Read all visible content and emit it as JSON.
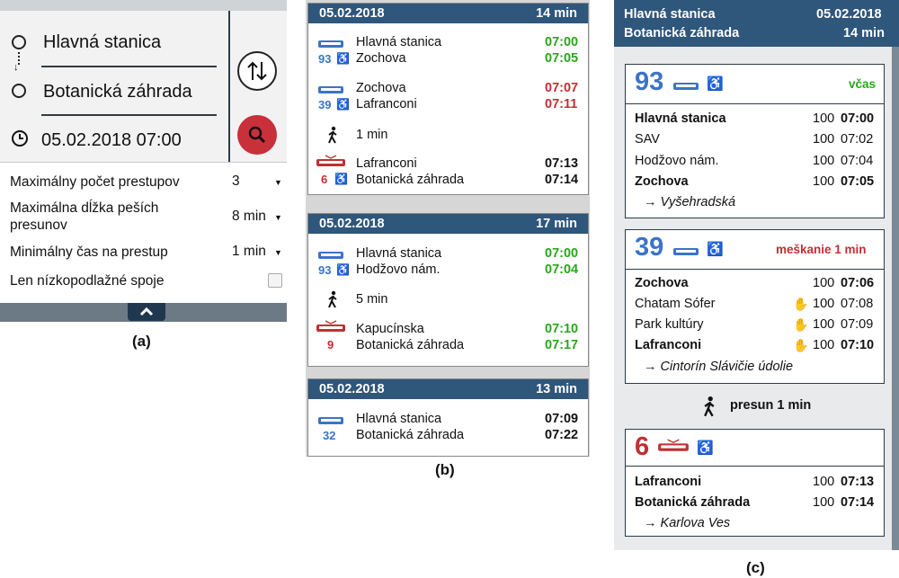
{
  "panel_a": {
    "from": "Hlavná stanica",
    "to": "Botanická záhrada",
    "datetime": "05.02.2018 07:00",
    "options": [
      {
        "label": "Maximálny počet prestupov",
        "value": "3"
      },
      {
        "label": "Maximálna dĺžka peších presunov",
        "value": "8 min"
      },
      {
        "label": "Minimálny čas na prestup",
        "value": "1 min"
      },
      {
        "label": "Len nízkopodlažné spoje",
        "value": ""
      }
    ],
    "caption": "(a)"
  },
  "panel_b": {
    "caption": "(b)",
    "results": [
      {
        "date": "05.02.2018",
        "duration": "14 min",
        "legs": [
          {
            "type": "bus",
            "route": "93",
            "accessible": true,
            "from": "Hlavná stanica",
            "to": "Zochova",
            "dep": "07:00",
            "arr": "07:05",
            "status": "green"
          },
          {
            "type": "bus",
            "route": "39",
            "accessible": true,
            "from": "Zochova",
            "to": "Lafranconi",
            "dep": "07:07",
            "arr": "07:11",
            "status": "red"
          },
          {
            "type": "walk",
            "text": "1 min"
          },
          {
            "type": "tram",
            "route": "6",
            "accessible": true,
            "from": "Lafranconi",
            "to": "Botanická záhrada",
            "dep": "07:13",
            "arr": "07:14",
            "status": "black"
          }
        ]
      },
      {
        "date": "05.02.2018",
        "duration": "17 min",
        "legs": [
          {
            "type": "bus",
            "route": "93",
            "accessible": true,
            "from": "Hlavná stanica",
            "to": "Hodžovo nám.",
            "dep": "07:00",
            "arr": "07:04",
            "status": "green"
          },
          {
            "type": "walk",
            "text": "5 min"
          },
          {
            "type": "tram",
            "route": "9",
            "accessible": false,
            "from": "Kapucínska",
            "to": "Botanická záhrada",
            "dep": "07:10",
            "arr": "07:17",
            "status": "green"
          }
        ]
      },
      {
        "date": "05.02.2018",
        "duration": "13 min",
        "legs": [
          {
            "type": "bus",
            "route": "32",
            "accessible": false,
            "from": "Hlavná stanica",
            "to": "Botanická záhrada",
            "dep": "07:09",
            "arr": "07:22",
            "status": "black"
          }
        ]
      }
    ]
  },
  "panel_c": {
    "caption": "(c)",
    "header": {
      "from": "Hlavná stanica",
      "date": "05.02.2018",
      "to": "Botanická záhrada",
      "duration": "14 min"
    },
    "legs": [
      {
        "route": "93",
        "mode": "bus",
        "status": "včas",
        "status_color": "#2aa61c",
        "stops": [
          {
            "name": "Hlavná stanica",
            "pos": "100",
            "time": "07:00",
            "bold": true
          },
          {
            "name": "SAV",
            "pos": "100",
            "time": "07:02",
            "bold": false
          },
          {
            "name": "Hodžovo nám.",
            "pos": "100",
            "time": "07:04",
            "bold": false
          },
          {
            "name": "Zochova",
            "pos": "100",
            "time": "07:05",
            "bold": true
          }
        ],
        "direction": "→ Vyšehradská"
      },
      {
        "route": "39",
        "mode": "bus",
        "status": "meškanie 1 min",
        "status_color": "#c22f33",
        "stops": [
          {
            "name": "Zochova",
            "pos": "100",
            "time": "07:06",
            "bold": true,
            "request": false
          },
          {
            "name": "Chatam Sófer",
            "pos": "100",
            "time": "07:08",
            "bold": false,
            "request": true
          },
          {
            "name": "Park kultúry",
            "pos": "100",
            "time": "07:09",
            "bold": false,
            "request": true
          },
          {
            "name": "Lafranconi",
            "pos": "100",
            "time": "07:10",
            "bold": true,
            "request": true
          }
        ],
        "direction": "→ Cintorín Slávičie údolie"
      },
      {
        "route": "6",
        "mode": "tram",
        "status": "",
        "stops": [
          {
            "name": "Lafranconi",
            "pos": "100",
            "time": "07:13",
            "bold": true
          },
          {
            "name": "Botanická záhrada",
            "pos": "100",
            "time": "07:14",
            "bold": true
          }
        ],
        "direction": "→ Karlova Ves"
      }
    ],
    "transfer": "presun 1 min"
  }
}
